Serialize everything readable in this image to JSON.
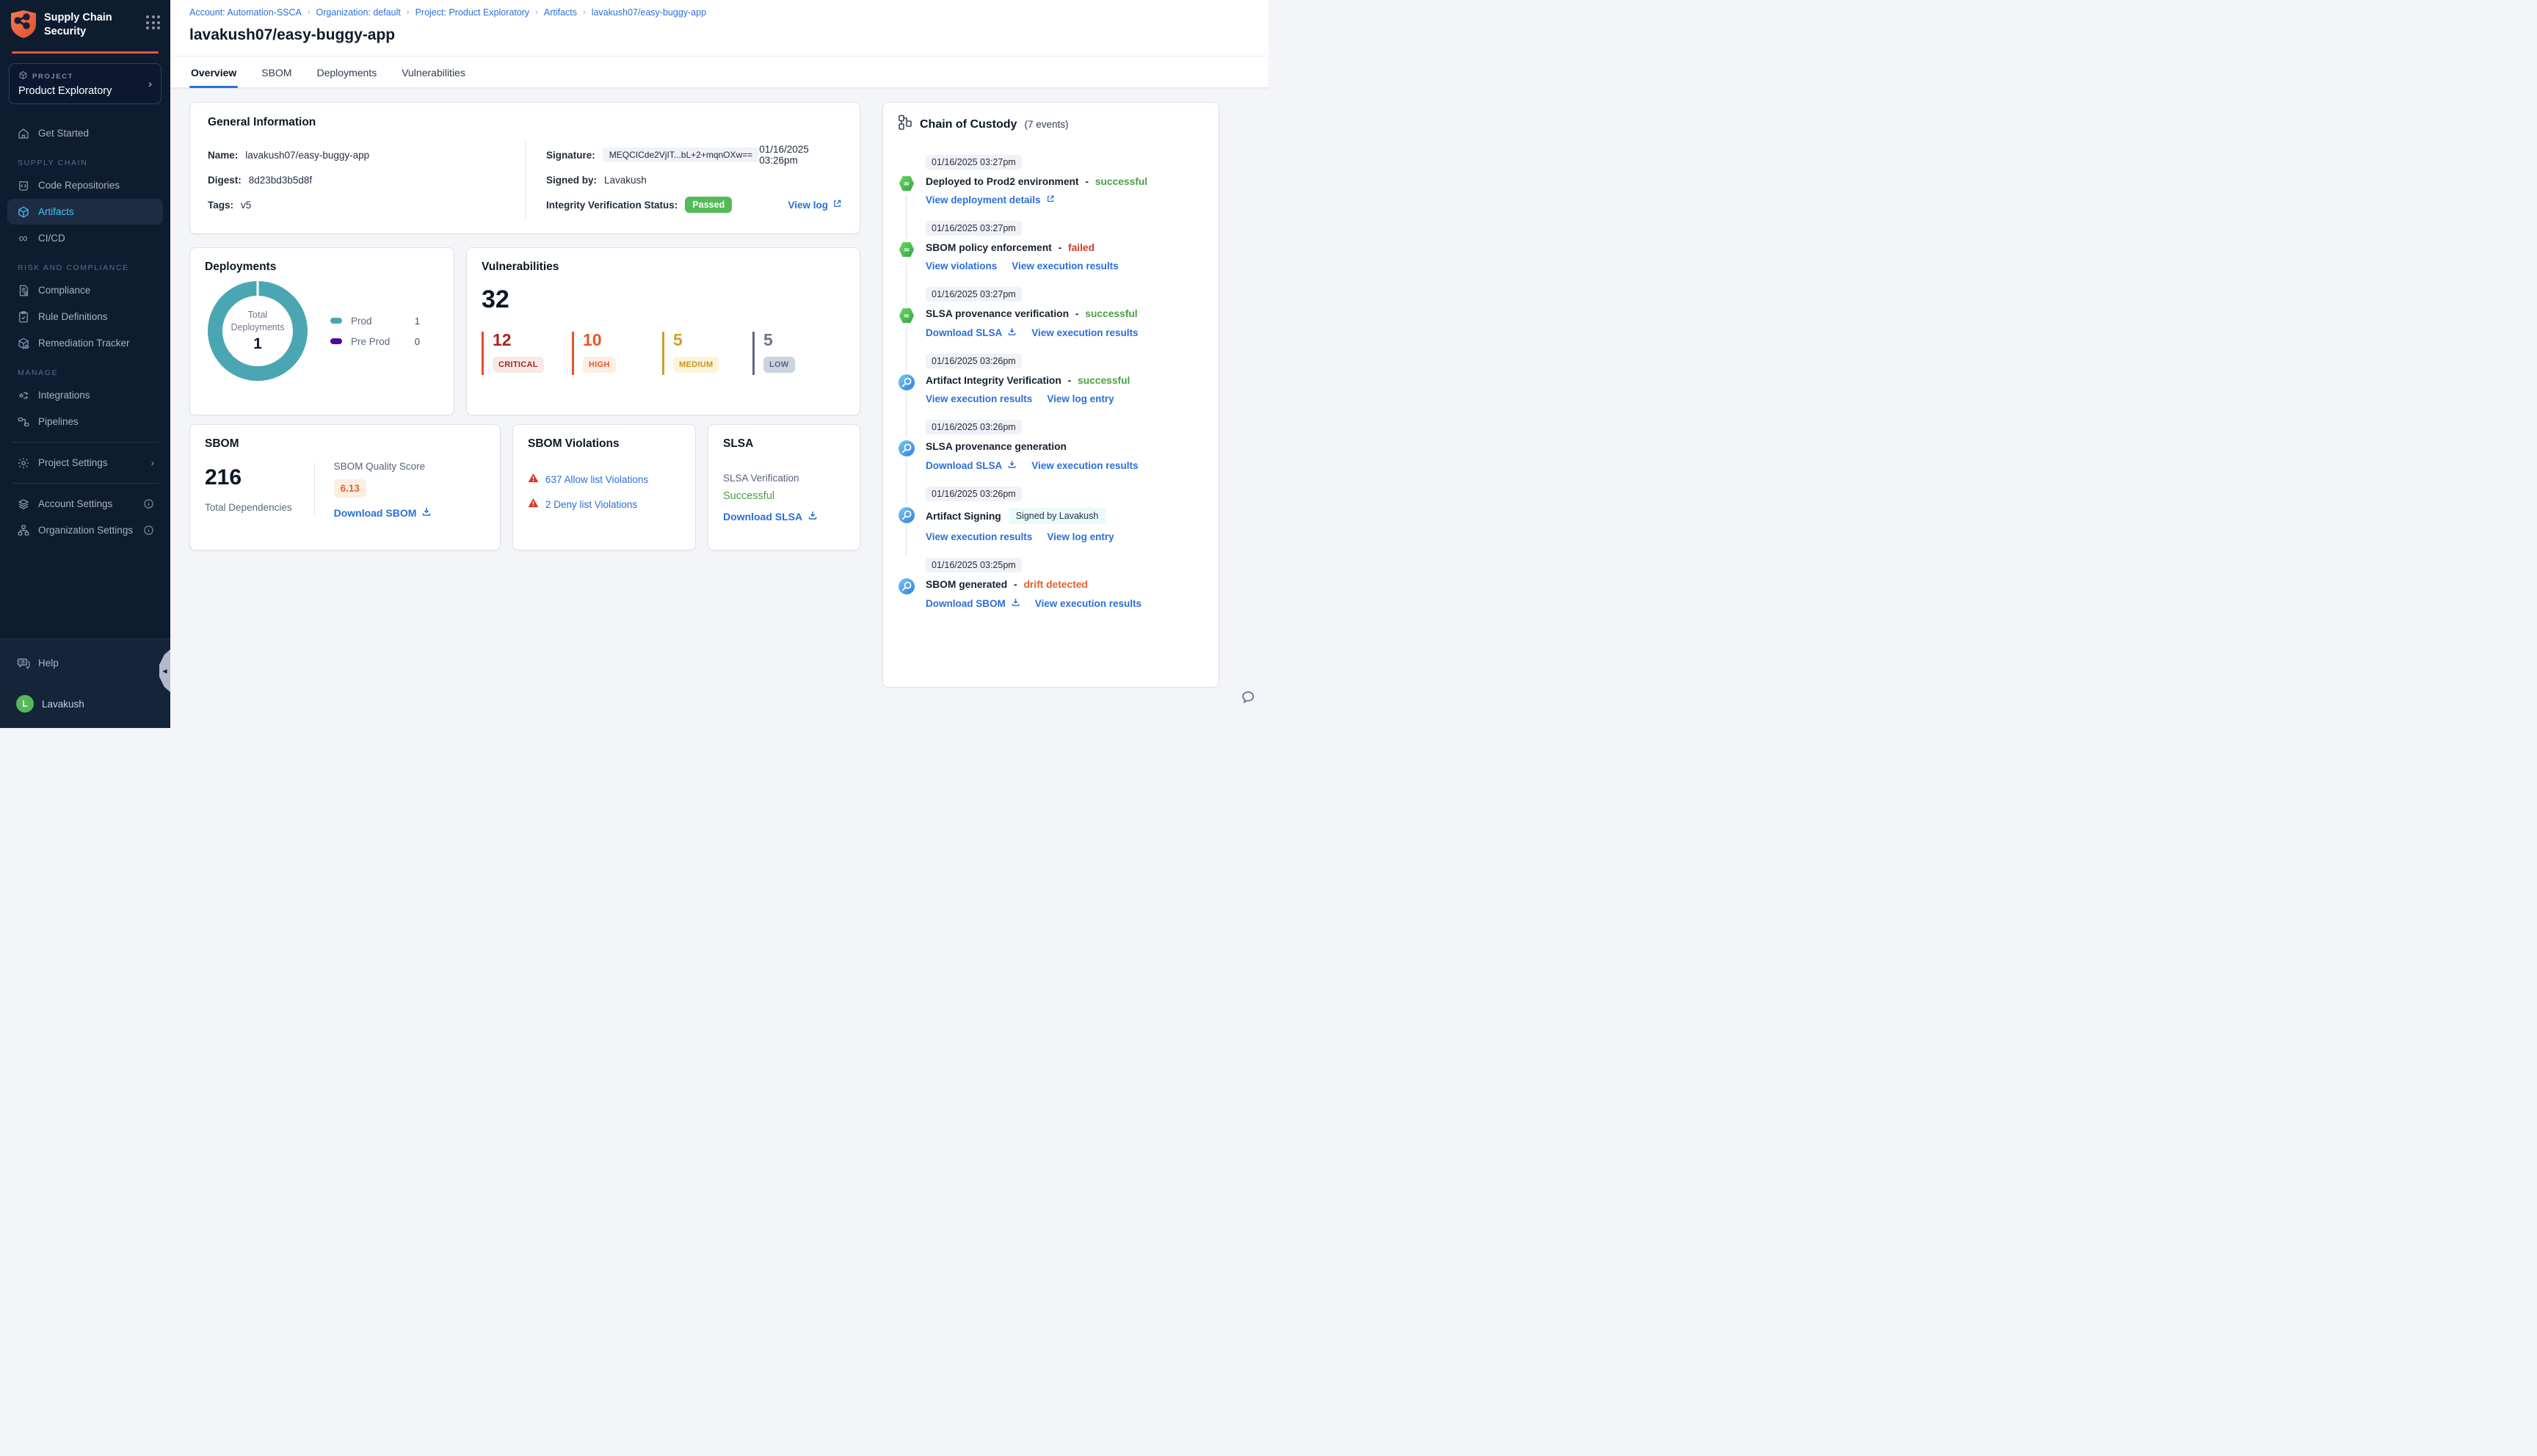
{
  "colors": {
    "accent_red": "#e85440",
    "link_blue": "#2a6fd9",
    "active_nav_blue": "#41c3f2",
    "success_green": "#4a9e44",
    "failed_red": "#cf3a2d",
    "drift_orange": "#ee5c2c",
    "passed_badge_green": "#53bb57",
    "prod_teal": "#4aa6b2",
    "preprod_purple": "#4d0b9e",
    "critical_red": "#a8251c",
    "high_orange": "#e8542b",
    "medium_gold": "#d49d2a",
    "low_slate": "#6b7390",
    "score_orange": "#e8622c",
    "sidebar_bg": "#0e1c30"
  },
  "sidebar": {
    "brand_title": "Supply Chain Security",
    "project_label": "PROJECT",
    "project_name": "Product Exploratory",
    "get_started": "Get Started",
    "section_supply_chain": "SUPPLY CHAIN",
    "code_repositories": "Code Repositories",
    "artifacts": "Artifacts",
    "cicd": "CI/CD",
    "section_risk": "RISK AND COMPLIANCE",
    "compliance": "Compliance",
    "rule_definitions": "Rule Definitions",
    "remediation_tracker": "Remediation Tracker",
    "section_manage": "MANAGE",
    "integrations": "Integrations",
    "pipelines": "Pipelines",
    "project_settings": "Project Settings",
    "account_settings": "Account Settings",
    "organization_settings": "Organization Settings",
    "help": "Help",
    "user_name": "Lavakush",
    "user_initial": "L"
  },
  "header": {
    "breadcrumb": [
      "Account: Automation-SSCA",
      "Organization: default",
      "Project: Product Exploratory",
      "Artifacts",
      "lavakush07/easy-buggy-app"
    ],
    "title": "lavakush07/easy-buggy-app"
  },
  "tabs": {
    "overview": "Overview",
    "sbom": "SBOM",
    "deployments": "Deployments",
    "vulnerabilities": "Vulnerabilities"
  },
  "general_info": {
    "title": "General Information",
    "name_label": "Name:",
    "name_value": "lavakush07/easy-buggy-app",
    "digest_label": "Digest:",
    "digest_value": "8d23bd3b5d8f",
    "tags_label": "Tags:",
    "tags_value": "v5",
    "signature_label": "Signature:",
    "signature_value": "MEQCICde2VjIT...bL+2+mqnOXw==",
    "signature_date": "01/16/2025 03:26pm",
    "signed_by_label": "Signed by:",
    "signed_by_value": "Lavakush",
    "integrity_label": "Integrity Verification Status:",
    "integrity_badge": "Passed",
    "view_log": "View log"
  },
  "deployments_card": {
    "title": "Deployments",
    "center_label": "Total Deployments",
    "center_value": "1",
    "legend": [
      {
        "label": "Prod",
        "value": "1"
      },
      {
        "label": "Pre Prod",
        "value": "0"
      }
    ]
  },
  "vulnerabilities_card": {
    "title": "Vulnerabilities",
    "total": "32",
    "severities": [
      {
        "count": "12",
        "label": "CRITICAL"
      },
      {
        "count": "10",
        "label": "HIGH"
      },
      {
        "count": "5",
        "label": "MEDIUM"
      },
      {
        "count": "5",
        "label": "LOW"
      }
    ]
  },
  "sbom_card": {
    "title": "SBOM",
    "total": "216",
    "total_label": "Total Dependencies",
    "score_label": "SBOM Quality Score",
    "score": "6.13",
    "download_link": "Download SBOM"
  },
  "sbom_violations_card": {
    "title": "SBOM Violations",
    "allow_link": "637 Allow list Violations",
    "deny_link": "2 Deny list Violations"
  },
  "slsa_card": {
    "title": "SLSA",
    "verification_label": "SLSA Verification",
    "status": "Successful",
    "download_link": "Download SLSA"
  },
  "chain_of_custody": {
    "title": "Chain of Custody",
    "events_label": "(7 events)",
    "events": [
      {
        "time": "01/16/2025 03:27pm",
        "title": "Deployed to Prod2 environment",
        "sep": "-",
        "status": "successful",
        "link1": "View deployment details"
      },
      {
        "time": "01/16/2025 03:27pm",
        "title": "SBOM policy enforcement",
        "sep": "-",
        "status": "failed",
        "link1": "View violations",
        "link2": "View execution results"
      },
      {
        "time": "01/16/2025 03:27pm",
        "title": "SLSA provenance verification",
        "sep": "-",
        "status": "successful",
        "link1": "Download SLSA",
        "link2": "View execution results"
      },
      {
        "time": "01/16/2025 03:26pm",
        "title": "Artifact Integrity Verification",
        "sep": "-",
        "status": "successful",
        "link1": "View execution results",
        "link2": "View log entry"
      },
      {
        "time": "01/16/2025 03:26pm",
        "title": "SLSA provenance generation",
        "link1": "Download SLSA",
        "link2": "View execution results"
      },
      {
        "time": "01/16/2025 03:26pm",
        "title": "Artifact Signing",
        "badge": "Signed by Lavakush",
        "link1": "View execution results",
        "link2": "View log entry"
      },
      {
        "time": "01/16/2025 03:25pm",
        "title": "SBOM generated",
        "sep": "-",
        "status": "drift detected",
        "link1": "Download SBOM",
        "link2": "View execution results"
      }
    ]
  }
}
